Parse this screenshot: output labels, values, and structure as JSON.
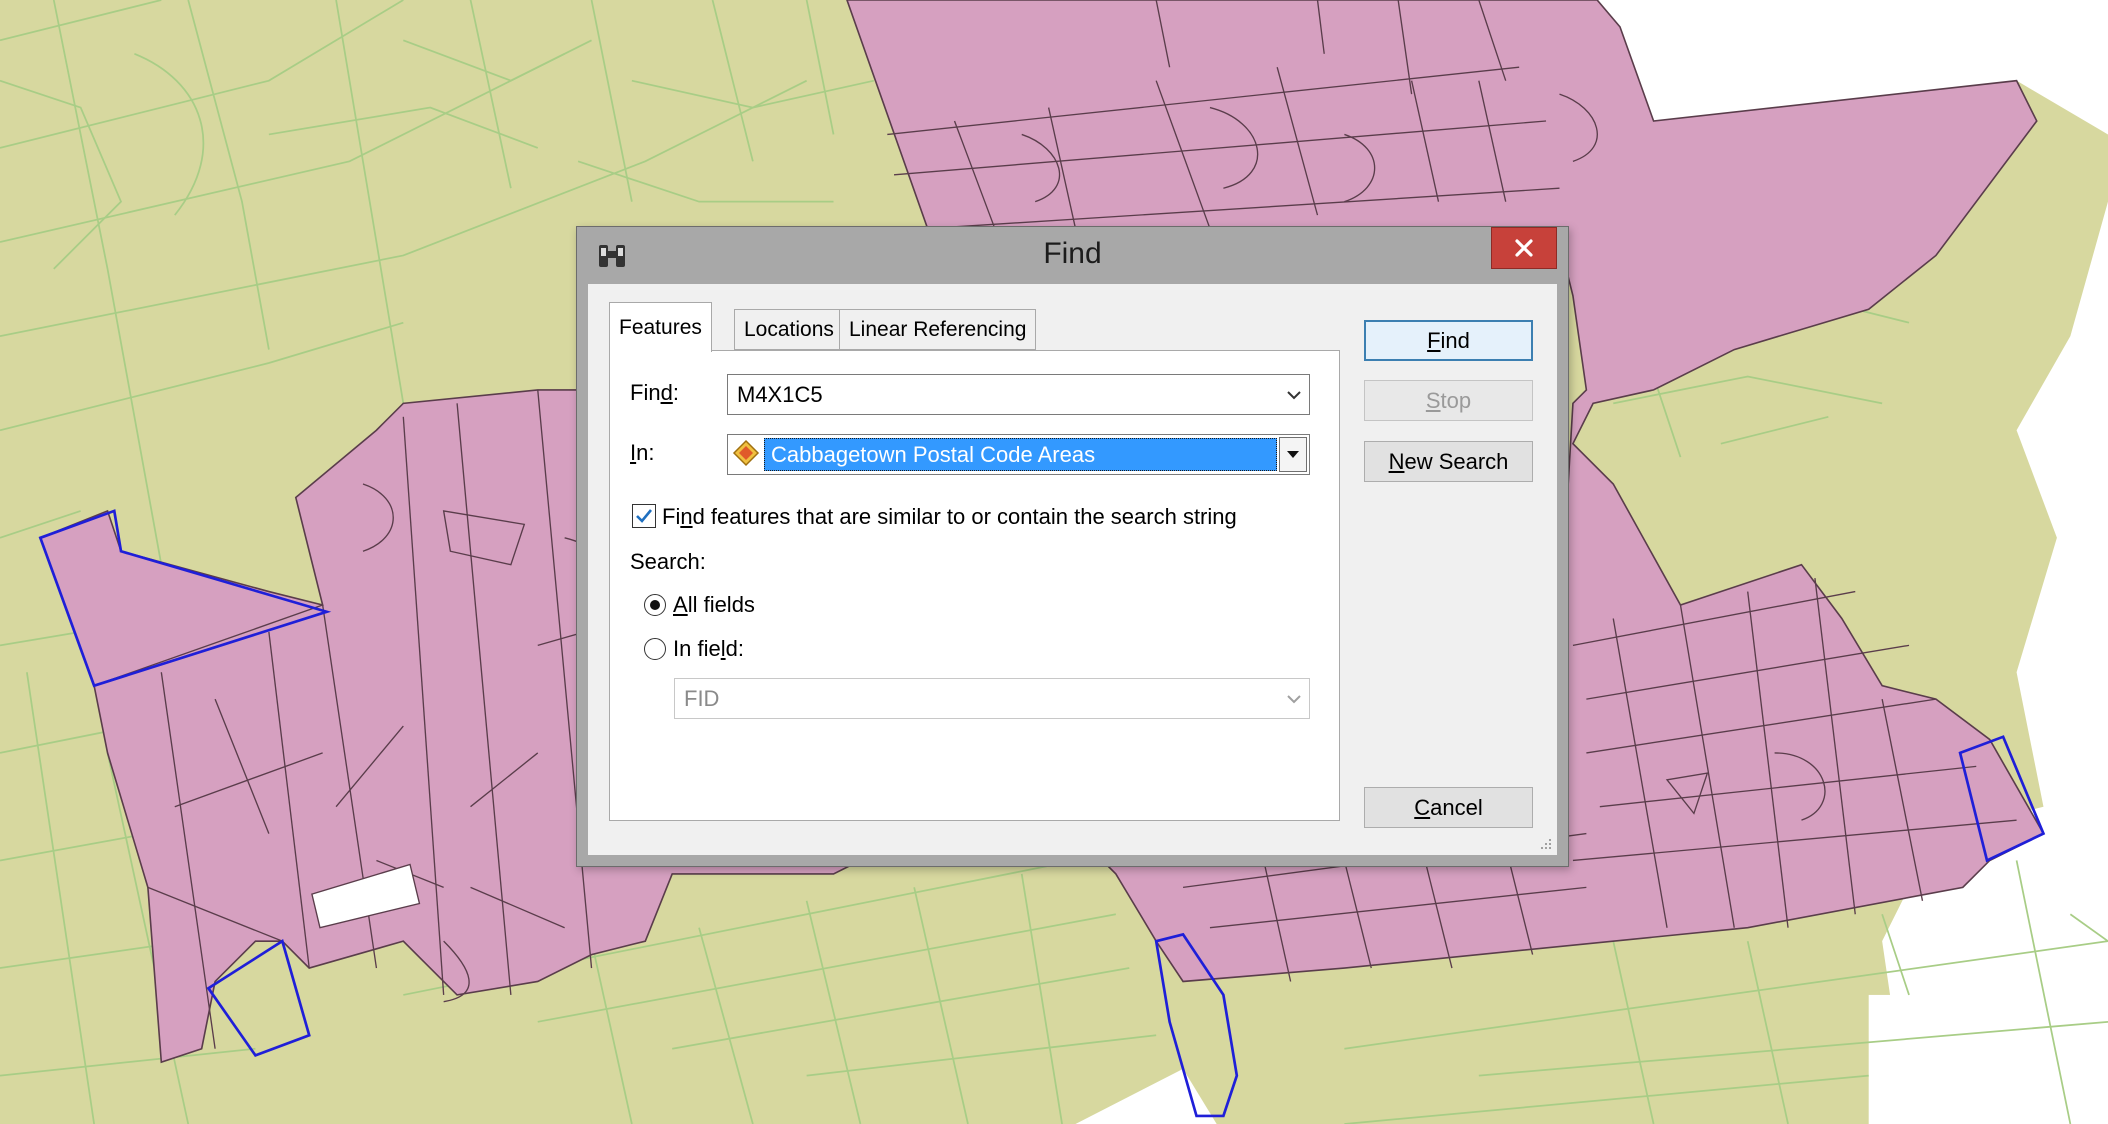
{
  "dialog": {
    "title": "Find",
    "tabs": [
      {
        "label": "Features",
        "active": true
      },
      {
        "label": "Locations",
        "active": false
      },
      {
        "label": "Linear Referencing",
        "active": false
      }
    ],
    "find_label_pre": "Fin",
    "find_label_mn": "d",
    "find_label_post": ":",
    "find_value": "M4X1C5",
    "in_label_mn": "I",
    "in_label_post": "n:",
    "in_value": "Cabbagetown Postal Code Areas",
    "similar_checkbox": {
      "checked": true,
      "label_pre": "Fi",
      "label_mn": "n",
      "label_post": "d features that are similar to or contain the search string"
    },
    "search_label": "Search:",
    "radio_all": {
      "selected": true,
      "label_mn": "A",
      "label_post": "ll fields"
    },
    "radio_field": {
      "selected": false,
      "label_pre": "In fie",
      "label_mn": "l",
      "label_post": "d:"
    },
    "field_value": "FID",
    "buttons": {
      "find": {
        "mn": "F",
        "rest": "ind"
      },
      "stop": {
        "mn": "S",
        "rest": "top"
      },
      "new_search": {
        "mn": "N",
        "rest": "ew Search"
      },
      "cancel": {
        "mn": "C",
        "rest": "ancel"
      }
    }
  },
  "map": {
    "colors": {
      "background": "#d7d89f",
      "neighborhood_fill": "#d6a0c0",
      "boundary_line": "#a8cd86",
      "parcel_line": "#5a3d4b",
      "selected_outline": "#1f1fd8",
      "empty": "#ffffff"
    }
  },
  "icons": {
    "title": "binoculars-icon",
    "close": "close-icon",
    "layer": "polygon-layer-icon",
    "dropdown": "chevron-down-icon"
  }
}
